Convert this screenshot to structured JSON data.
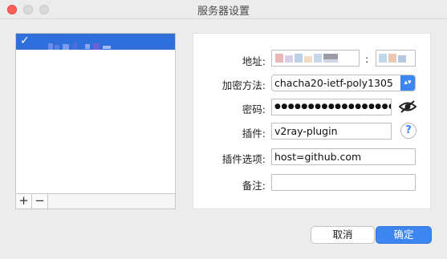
{
  "window": {
    "title": "服务器设置"
  },
  "server_list": {
    "items": [
      {
        "checked": true,
        "check_glyph": "✓"
      }
    ],
    "add_label": "+",
    "remove_label": "−"
  },
  "form": {
    "address_label": "地址:",
    "port_separator": ":",
    "encryption_label": "加密方法:",
    "encryption_value": "chacha20-ietf-poly1305",
    "password_label": "密码:",
    "password_value": "●●●●●●●●●●●●●●●●●●●●",
    "plugin_label": "插件:",
    "plugin_value": "v2ray-plugin",
    "plugin_help": "?",
    "plugin_options_label": "插件选项:",
    "plugin_options_value": "host=github.com",
    "remarks_label": "备注:",
    "remarks_value": ""
  },
  "buttons": {
    "cancel": "取消",
    "ok": "确定"
  },
  "colors": {
    "accent": "#3d86f2",
    "selection": "#2e6fdc",
    "close": "#fc5f57"
  }
}
